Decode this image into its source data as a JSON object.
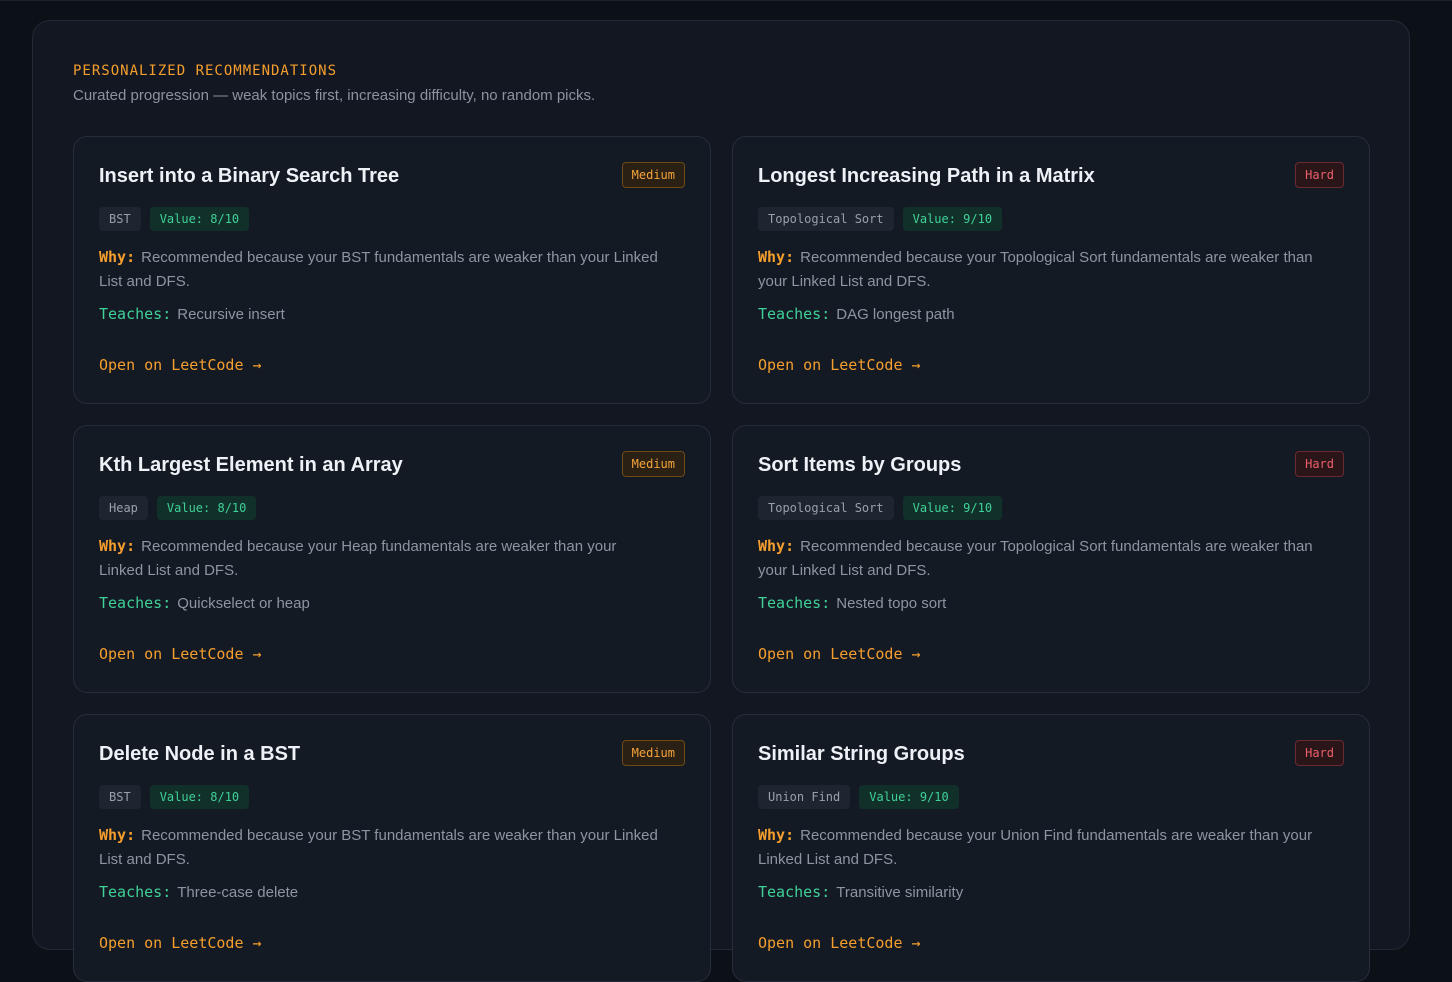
{
  "section": {
    "title": "PERSONALIZED RECOMMENDATIONS",
    "subtitle": "Curated progression — weak topics first, increasing difficulty, no random picks."
  },
  "labels": {
    "why": "Why:",
    "teaches": "Teaches:",
    "open": "Open on LeetCode →"
  },
  "colors": {
    "accent": "#f59e2d",
    "green": "#3fd197",
    "hard": "#ef5f6a",
    "background": "#0c1017",
    "panel": "#121721"
  },
  "cards": [
    {
      "title": "Insert into a Binary Search Tree",
      "difficulty": "Medium",
      "topic": "BST",
      "value": "Value: 8/10",
      "why": "Recommended because your BST fundamentals are weaker than your Linked List and DFS.",
      "teaches": "Recursive insert"
    },
    {
      "title": "Longest Increasing Path in a Matrix",
      "difficulty": "Hard",
      "topic": "Topological Sort",
      "value": "Value: 9/10",
      "why": "Recommended because your Topological Sort fundamentals are weaker than your Linked List and DFS.",
      "teaches": "DAG longest path"
    },
    {
      "title": "Kth Largest Element in an Array",
      "difficulty": "Medium",
      "topic": "Heap",
      "value": "Value: 8/10",
      "why": "Recommended because your Heap fundamentals are weaker than your Linked List and DFS.",
      "teaches": "Quickselect or heap"
    },
    {
      "title": "Sort Items by Groups",
      "difficulty": "Hard",
      "topic": "Topological Sort",
      "value": "Value: 9/10",
      "why": "Recommended because your Topological Sort fundamentals are weaker than your Linked List and DFS.",
      "teaches": "Nested topo sort"
    },
    {
      "title": "Delete Node in a BST",
      "difficulty": "Medium",
      "topic": "BST",
      "value": "Value: 8/10",
      "why": "Recommended because your BST fundamentals are weaker than your Linked List and DFS.",
      "teaches": "Three-case delete"
    },
    {
      "title": "Similar String Groups",
      "difficulty": "Hard",
      "topic": "Union Find",
      "value": "Value: 9/10",
      "why": "Recommended because your Union Find fundamentals are weaker than your Linked List and DFS.",
      "teaches": "Transitive similarity"
    }
  ]
}
